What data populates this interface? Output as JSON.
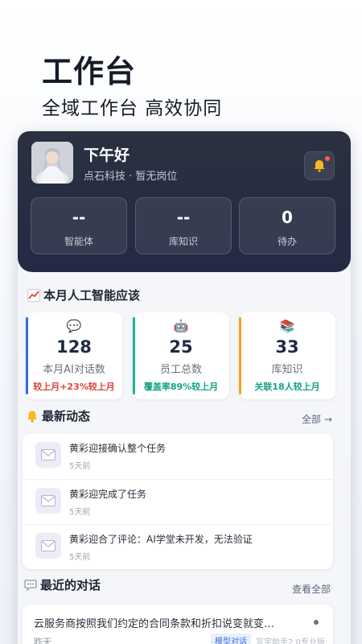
{
  "hero": {
    "title": "工作台",
    "subtitle": "全域工作台 高效协同"
  },
  "header": {
    "greeting": "下午好",
    "org": "点石科技 · 暂无岗位",
    "stats": [
      {
        "value": "--",
        "label": "智能体"
      },
      {
        "value": "--",
        "label": "库知识"
      },
      {
        "value": "0",
        "label": "待办"
      }
    ]
  },
  "monthly": {
    "title": "本月人工智能应该",
    "cards": [
      {
        "icon": "💬",
        "value": "128",
        "label": "本月AI对话数",
        "sub": "较上月+23%较上月",
        "color": "#2f6fdf",
        "sub_color": "#e0433a"
      },
      {
        "icon": "🤖",
        "value": "25",
        "label": "员工总数",
        "sub": "覆盖率89%较上月",
        "color": "#1fb58f",
        "sub_color": "#17a383"
      },
      {
        "icon": "📚",
        "value": "33",
        "label": "库知识",
        "sub": "关联18人较上月",
        "color": "#f2a420",
        "sub_color": "#17a383"
      }
    ]
  },
  "activity": {
    "title": "最新动态",
    "more": "全部 →",
    "items": [
      {
        "text": "黄彩迎接确认整个任务",
        "time": "5天前"
      },
      {
        "text": "黄彩迎完成了任务",
        "time": "5天前"
      },
      {
        "text": "黄彩迎合了评论：AI学堂未开发，无法验证",
        "time": "5天前"
      }
    ]
  },
  "conversations": {
    "title": "最近的对话",
    "more": "查看全部",
    "items": [
      {
        "title": "云服务商按照我们约定的合同条款和折扣说变就变…",
        "time": "昨天",
        "tag": "模型对话",
        "meta": "写字助手2.0专业版"
      }
    ]
  }
}
